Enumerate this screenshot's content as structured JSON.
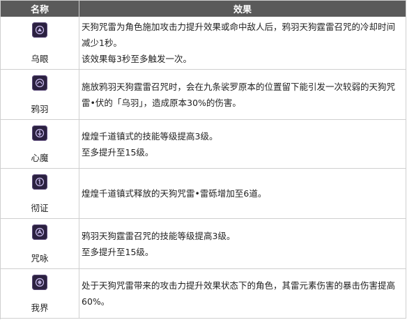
{
  "header": {
    "name_label": "名称",
    "effect_label": "效果"
  },
  "rows": [
    {
      "name": "乌眼",
      "icon": "constellation-icon",
      "lines": [
        "天狗咒雷为角色施加攻击力提升效果或命中敌人后，鸦羽天狗霆雷召咒的冷却时间减少1秒。",
        "该效果每3秒至多触发一次。"
      ]
    },
    {
      "name": "鸦羽",
      "icon": "constellation-icon",
      "lines": [
        "施放鸦羽天狗霆雷召咒时，会在九条裟罗原本的位置留下能引发一次较弱的天狗咒雷•伏的「乌羽」，造成原本30%的伤害。"
      ]
    },
    {
      "name": "心魔",
      "icon": "constellation-icon",
      "lines": [
        "煌煌千道镇式的技能等级提高3级。",
        "至多提升至15级。"
      ]
    },
    {
      "name": "彻证",
      "icon": "constellation-icon",
      "lines": [
        "煌煌千道镇式释放的天狗咒雷•雷砾增加至6道。"
      ]
    },
    {
      "name": "咒咏",
      "icon": "constellation-icon",
      "lines": [
        "鸦羽天狗霆雷召咒的技能等级提高3级。",
        "至多提升至15级。"
      ]
    },
    {
      "name": "我界",
      "icon": "constellation-icon",
      "lines": [
        "处于天狗咒雷带来的攻击力提升效果状态下的角色，其雷元素伤害的暴击伤害提高60%。"
      ]
    }
  ],
  "colors": {
    "header_bg": "#5a5a5a",
    "header_text": "#ffffff",
    "border": "#cfcfcf",
    "icon_bg": "#2b2140",
    "icon_glyph": "#cbbcf0"
  }
}
